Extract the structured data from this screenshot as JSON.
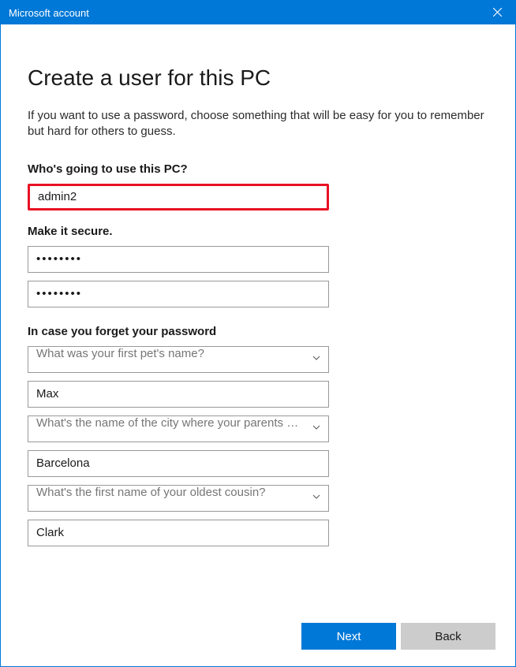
{
  "titlebar": {
    "title": "Microsoft account"
  },
  "main": {
    "heading": "Create a user for this PC",
    "description": "If you want to use a password, choose something that will be easy for you to remember but hard for others to guess.",
    "user_section_label": "Who's going to use this PC?",
    "username_value": "admin2",
    "password_section_label": "Make it secure.",
    "password_value": "••••••••",
    "confirm_password_value": "••••••••",
    "security_section_label": "In case you forget your password",
    "q1_text": "What was your first pet's name?",
    "a1_value": "Max",
    "q2_text": "What's the name of the city where your parents met?",
    "a2_value": "Barcelona",
    "q3_text": "What's the first name of your oldest cousin?",
    "a3_value": "Clark"
  },
  "footer": {
    "next_label": "Next",
    "back_label": "Back"
  }
}
